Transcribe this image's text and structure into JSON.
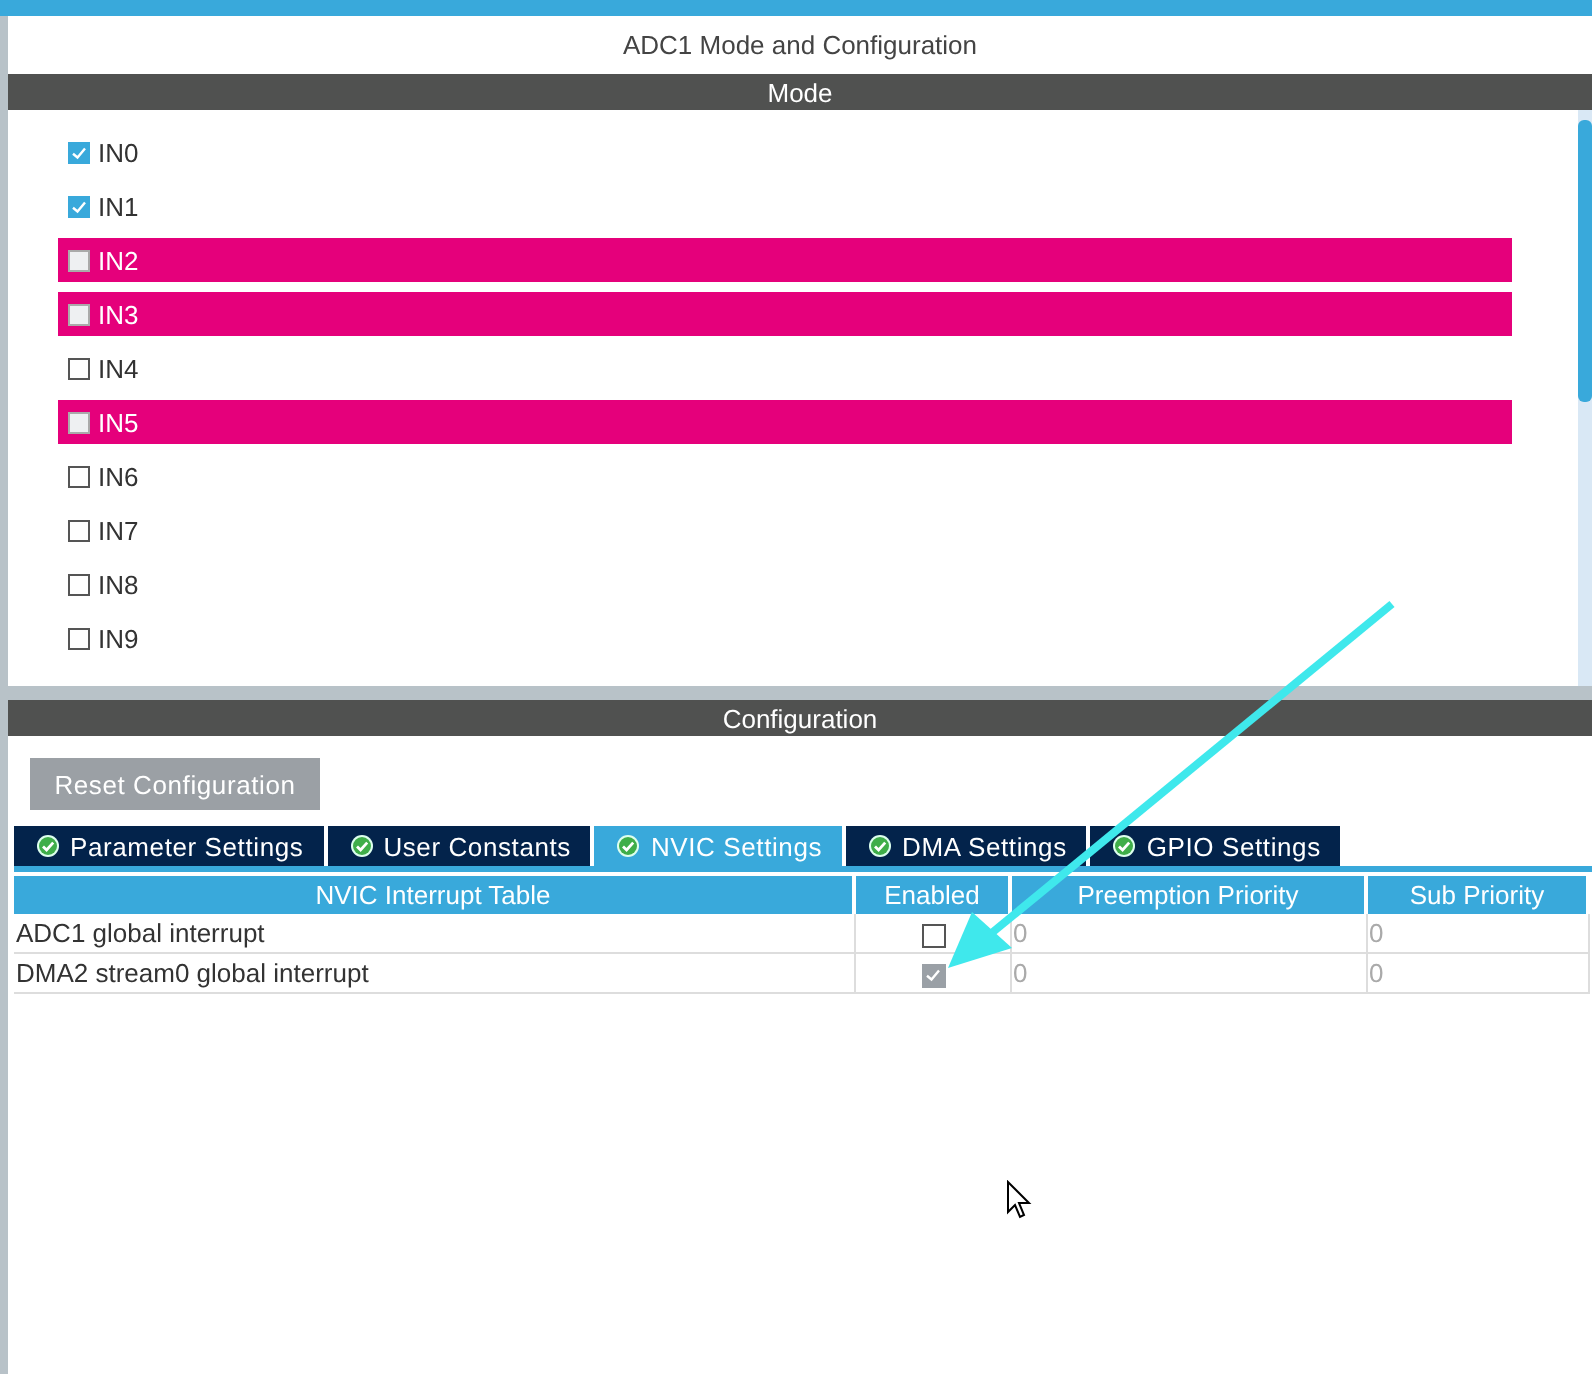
{
  "title": "ADC1 Mode and Configuration",
  "mode": {
    "header": "Mode",
    "channels": [
      {
        "label": "IN0",
        "checked": true,
        "highlighted": false
      },
      {
        "label": "IN1",
        "checked": true,
        "highlighted": false
      },
      {
        "label": "IN2",
        "checked": false,
        "highlighted": true
      },
      {
        "label": "IN3",
        "checked": false,
        "highlighted": true
      },
      {
        "label": "IN4",
        "checked": false,
        "highlighted": false
      },
      {
        "label": "IN5",
        "checked": false,
        "highlighted": true
      },
      {
        "label": "IN6",
        "checked": false,
        "highlighted": false
      },
      {
        "label": "IN7",
        "checked": false,
        "highlighted": false
      },
      {
        "label": "IN8",
        "checked": false,
        "highlighted": false
      },
      {
        "label": "IN9",
        "checked": false,
        "highlighted": false
      }
    ]
  },
  "configuration": {
    "header": "Configuration",
    "reset_button": "Reset Configuration",
    "tabs": [
      {
        "label": "Parameter Settings",
        "selected": false
      },
      {
        "label": "User Constants",
        "selected": false
      },
      {
        "label": "NVIC Settings",
        "selected": true
      },
      {
        "label": "DMA Settings",
        "selected": false
      },
      {
        "label": "GPIO Settings",
        "selected": false
      }
    ],
    "table": {
      "columns": [
        "NVIC Interrupt Table",
        "Enabled",
        "Preemption Priority",
        "Sub Priority"
      ],
      "rows": [
        {
          "name": "ADC1 global interrupt",
          "enabled": false,
          "disabled": false,
          "preemption_priority": "0",
          "sub_priority": "0"
        },
        {
          "name": "DMA2 stream0 global interrupt",
          "enabled": true,
          "disabled": true,
          "preemption_priority": "0",
          "sub_priority": "0"
        }
      ]
    }
  }
}
